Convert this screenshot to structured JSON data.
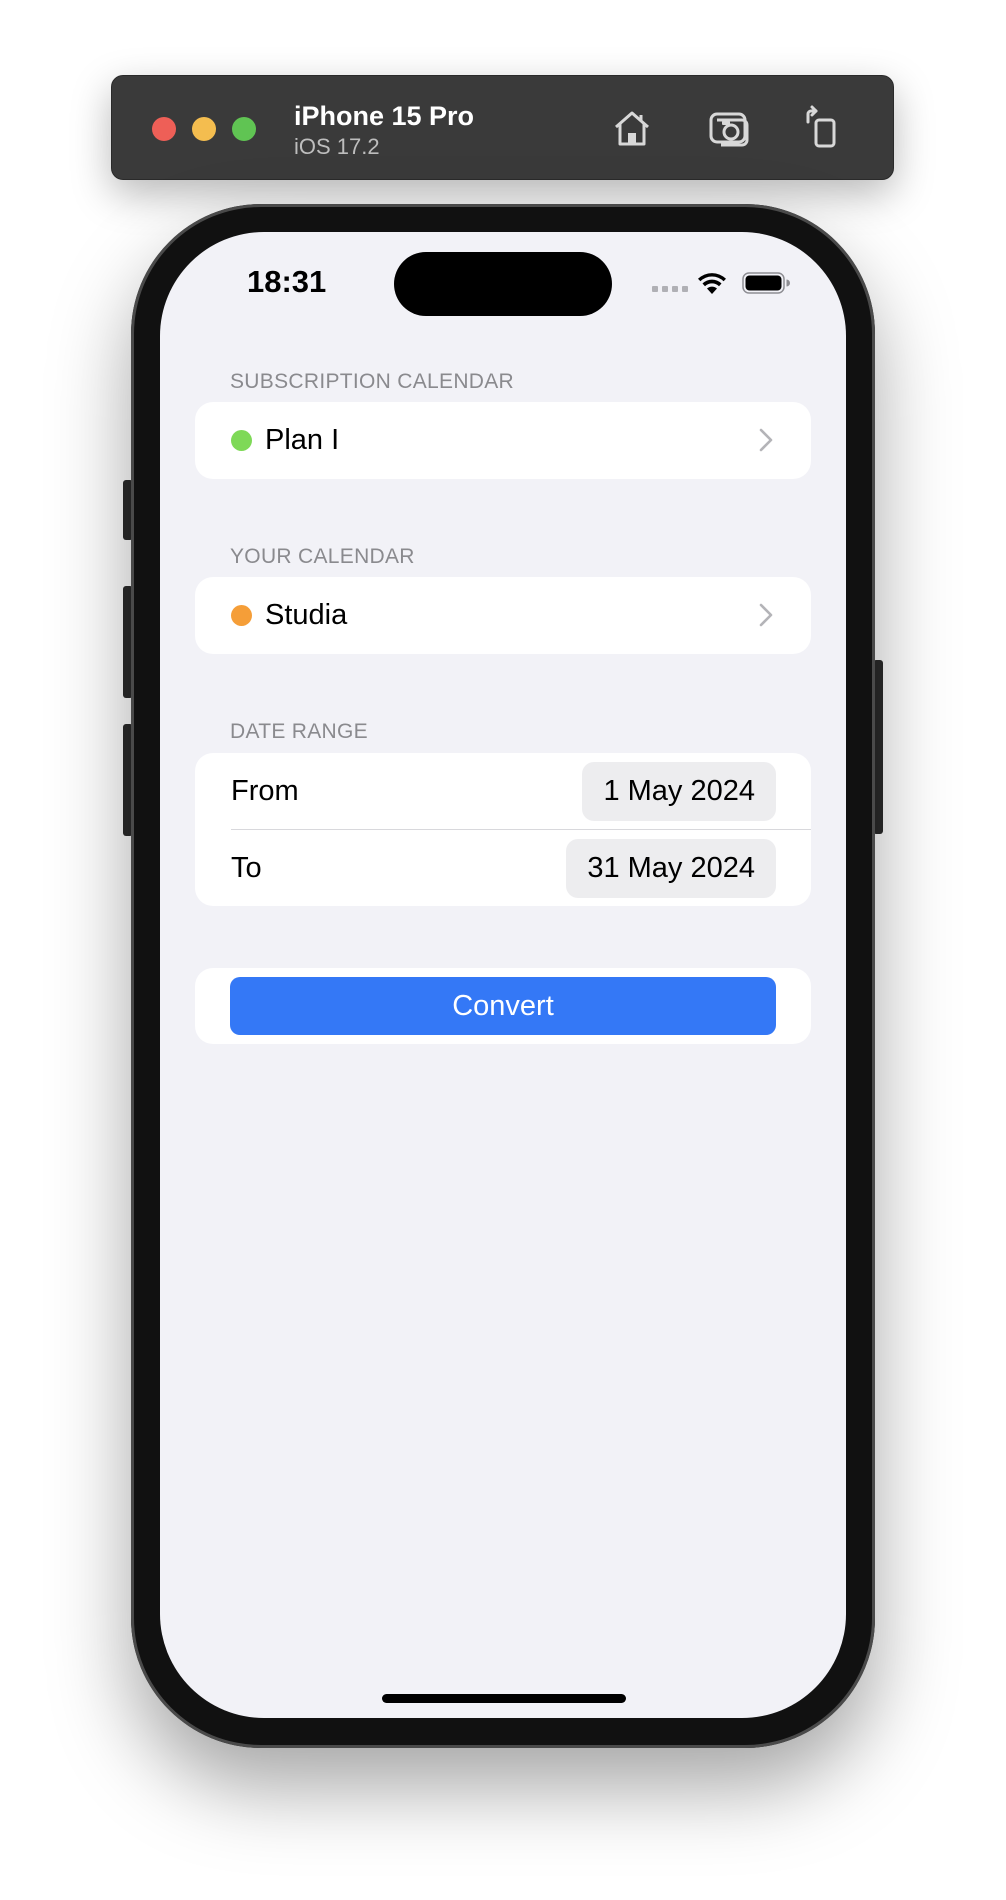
{
  "simulator": {
    "device_name": "iPhone 15 Pro",
    "os_version": "iOS 17.2",
    "toolbar_icons": [
      "home-icon",
      "screenshot-icon",
      "rotate-icon"
    ]
  },
  "status_bar": {
    "time": "18:31"
  },
  "subscription_section": {
    "header": "SUBSCRIPTION CALENDAR",
    "calendar_name": "Plan I",
    "calendar_color": "#7ed957"
  },
  "your_calendar_section": {
    "header": "YOUR CALENDAR",
    "calendar_name": "Studia",
    "calendar_color": "#f59e38"
  },
  "date_range_section": {
    "header": "DATE RANGE",
    "from_label": "From",
    "from_value": "1 May 2024",
    "to_label": "To",
    "to_value": "31 May 2024"
  },
  "actions": {
    "convert_label": "Convert",
    "convert_color": "#3478f6"
  }
}
